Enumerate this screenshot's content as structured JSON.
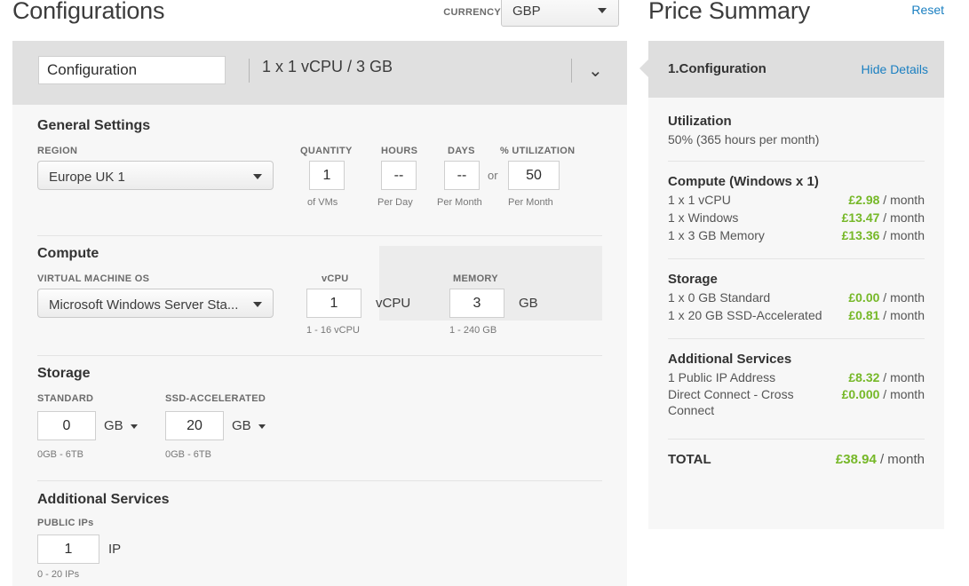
{
  "header": {
    "title": "Configurations",
    "currency_label": "CURRENCY",
    "currency_value": "GBP"
  },
  "config_strip": {
    "name_value": "Configuration",
    "name_placeholder": "Configuration",
    "spec_summary": "1 x 1 vCPU / 3 GB",
    "chevron": "⌄"
  },
  "general_settings": {
    "section_title": "General Settings",
    "region_label": "REGION",
    "region_value": "Europe UK 1",
    "quantity_label": "QUANTITY",
    "quantity_value": "1",
    "quantity_hint": "of VMs",
    "hours_label": "HOURS",
    "hours_value": "--",
    "hours_hint": "Per Day",
    "days_label": "DAYS",
    "days_value": "--",
    "days_hint": "Per Month",
    "or_text": "or",
    "utilization_label": "% UTILIZATION",
    "utilization_value": "50",
    "utilization_hint": "Per Month"
  },
  "compute": {
    "section_title": "Compute",
    "os_label": "VIRTUAL MACHINE OS",
    "os_value": "Microsoft Windows Server Sta...",
    "vcpu_label": "vCPU",
    "vcpu_value": "1",
    "vcpu_unit": "vCPU",
    "vcpu_hint": "1 - 16 vCPU",
    "memory_label": "MEMORY",
    "memory_value": "3",
    "memory_unit": "GB",
    "memory_hint": "1 - 240 GB"
  },
  "storage": {
    "section_title": "Storage",
    "standard_label": "STANDARD",
    "standard_value": "0",
    "standard_unit": "GB",
    "standard_hint": "0GB - 6TB",
    "ssd_label": "SSD-ACCELERATED",
    "ssd_value": "20",
    "ssd_unit": "GB",
    "ssd_hint": "0GB - 6TB"
  },
  "additional_services": {
    "section_title": "Additional Services",
    "public_ips_label": "PUBLIC IPs",
    "public_ips_value": "1",
    "public_ips_unit": "IP",
    "public_ips_hint": "0 - 20 IPs"
  },
  "price_summary": {
    "title": "Price Summary",
    "reset_label": "Reset",
    "card_header_title": "1.Configuration",
    "hide_details_label": "Hide Details",
    "utilization": {
      "title": "Utilization",
      "text": "50% (365 hours per month)"
    },
    "compute": {
      "title": "Compute (Windows x 1)",
      "rows": [
        {
          "desc": "1 x 1 vCPU",
          "money": "£2.98",
          "per": " / month"
        },
        {
          "desc": "1 x Windows",
          "money": "£13.47",
          "per": " / month"
        },
        {
          "desc": "1 x 3 GB Memory",
          "money": "£13.36",
          "per": " / month"
        }
      ]
    },
    "storage": {
      "title": "Storage",
      "rows": [
        {
          "desc": "1 x 0 GB Standard",
          "money": "£0.00",
          "per": " / month"
        },
        {
          "desc": "1 x 20 GB SSD-Accelerated",
          "money": "£0.81",
          "per": " / month"
        }
      ]
    },
    "additional_services": {
      "title": "Additional Services",
      "rows": [
        {
          "desc": "1 Public IP Address",
          "money": "£8.32",
          "per": " / month"
        },
        {
          "desc": "Direct Connect - Cross Connect",
          "money": "£0.000",
          "per": " / month"
        }
      ]
    },
    "total": {
      "label": "TOTAL",
      "money": "£38.94",
      "per": " / month"
    }
  },
  "colors": {
    "price_green": "#76b828",
    "link_blue": "#1a7fc1",
    "strip_gray": "#e0e0e0",
    "panel_gray": "#f7f7f7"
  }
}
